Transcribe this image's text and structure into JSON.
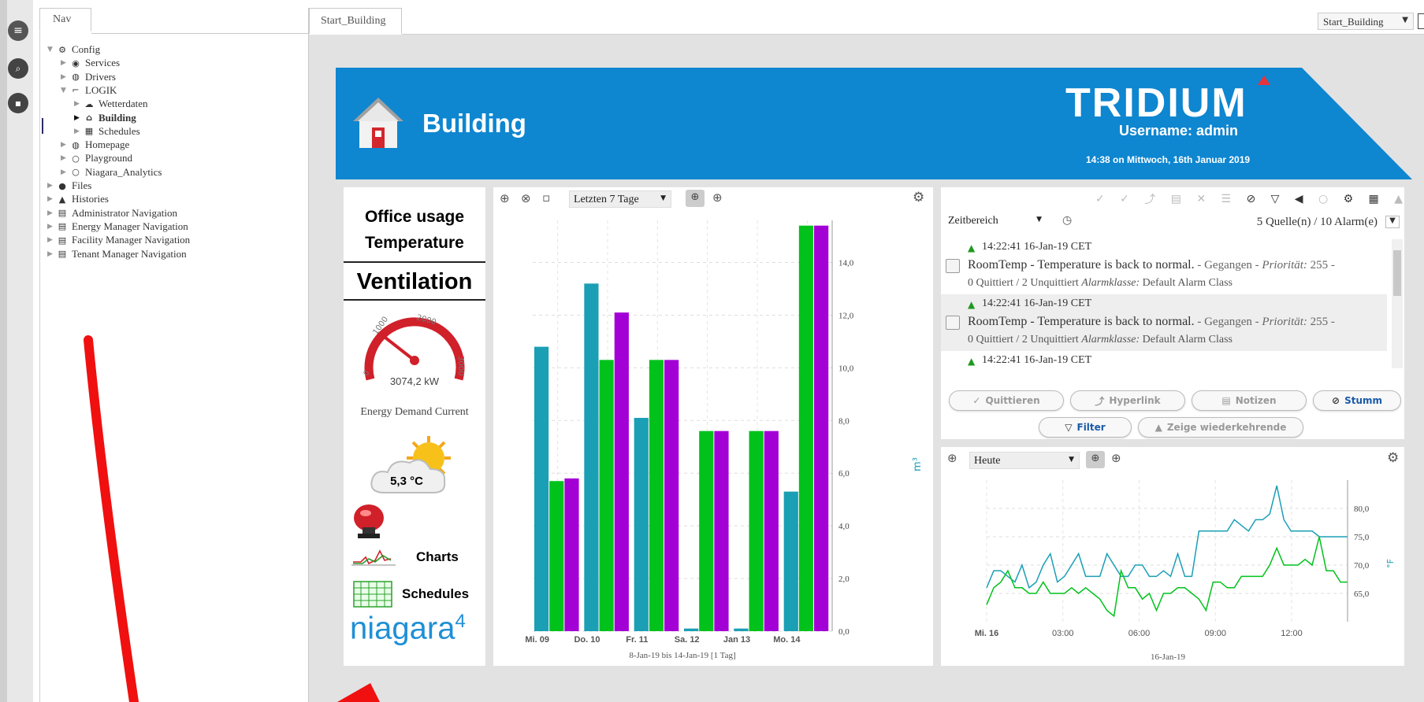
{
  "nav": {
    "tab_label": "Nav",
    "tree": [
      {
        "label": "Config",
        "icon": "config-icon",
        "level": 0,
        "expanded": true
      },
      {
        "label": "Services",
        "icon": "services-icon",
        "level": 1
      },
      {
        "label": "Drivers",
        "icon": "drivers-icon",
        "level": 1
      },
      {
        "label": "LOGIK",
        "icon": "logic-icon",
        "level": 1,
        "expanded": true
      },
      {
        "label": "Wetterdaten",
        "icon": "cloud-icon",
        "level": 2
      },
      {
        "label": "Building",
        "icon": "home-icon",
        "level": 2,
        "selected": true
      },
      {
        "label": "Schedules",
        "icon": "grid-icon",
        "level": 2
      },
      {
        "label": "Homepage",
        "icon": "globe-icon",
        "level": 1
      },
      {
        "label": "Playground",
        "icon": "circle-icon",
        "level": 1
      },
      {
        "label": "Niagara_Analytics",
        "icon": "circle-icon",
        "level": 1
      },
      {
        "label": "Files",
        "icon": "files-icon",
        "level": 0
      },
      {
        "label": "Histories",
        "icon": "histories-icon",
        "level": 0
      },
      {
        "label": "Administrator Navigation",
        "icon": "nav-file-icon",
        "level": 0
      },
      {
        "label": "Energy Manager Navigation",
        "icon": "nav-file-icon",
        "level": 0
      },
      {
        "label": "Facility Manager Navigation",
        "icon": "nav-file-icon",
        "level": 0
      },
      {
        "label": "Tenant Manager Navigation",
        "icon": "nav-file-icon",
        "level": 0
      }
    ]
  },
  "main": {
    "tab_label": "Start_Building",
    "view_select": "Start_Building"
  },
  "banner": {
    "title": "Building",
    "brand": "TRIDIUM",
    "username": "Username: admin",
    "timestamp": "14:38 on Mittwoch, 16th Januar 2019",
    "color": "#0e86d0"
  },
  "left_panel": {
    "line1": "Office usage",
    "line2": "Temperature",
    "ventilation": "Ventilation",
    "gauge": {
      "labels": [
        "0",
        "1000",
        "2000",
        "3000"
      ],
      "value": "3074,2 kW",
      "caption": "Energy Demand Current",
      "fraction": 1.0
    },
    "weather_temp": "5,3 °C",
    "charts_label": "Charts",
    "schedules_label": "Schedules",
    "logo": "niagara",
    "logo_sup": "4"
  },
  "bar_chart": {
    "range_select": "Letzten 7 Tage",
    "xlabel": "8-Jan-19 bis 14-Jan-19   [1 Tag]",
    "unit_label": "m³",
    "yticks": [
      "0,0",
      "2,0",
      "4,0",
      "6,0",
      "8,0",
      "10,0",
      "12,0",
      "14,0"
    ]
  },
  "alarms": {
    "time_range_select": "Zeitbereich",
    "source_count": "5 Quelle(n) / 10 Alarm(e)",
    "rows": [
      {
        "time": "14:22:41 16-Jan-19 CET",
        "msg": "RoomTemp - Temperature is back to normal.",
        "state": " - Gegangen - ",
        "prio_label": "Priorität:",
        "prio": " 255 -",
        "ack": "0 Quittiert / 2 Unquittiert ",
        "class_label": "Alarmklasse:",
        "class_val": " Default Alarm Class"
      },
      {
        "time": "14:22:41 16-Jan-19 CET",
        "msg": "RoomTemp - Temperature is back to normal.",
        "state": " - Gegangen - ",
        "prio_label": "Priorität:",
        "prio": " 255 -",
        "ack": "0 Quittiert / 2 Unquittiert ",
        "class_label": "Alarmklasse:",
        "class_val": " Default Alarm Class"
      },
      {
        "time": "14:22:41 16-Jan-19 CET"
      }
    ],
    "buttons": {
      "ack": "Quittieren",
      "hyperlink": "Hyperlink",
      "notes": "Notizen",
      "silence": "Stumm",
      "filter": "Filter",
      "recurring": "Zeige wiederkehrende"
    }
  },
  "trend": {
    "range_select": "Heute",
    "date_label": "16-Jan-19",
    "unit_label": "°F",
    "yticks": [
      "65,0",
      "70,0",
      "75,0",
      "80,0"
    ],
    "xticks": [
      "Mi. 16",
      "03:00",
      "06:00",
      "09:00",
      "12:00"
    ]
  },
  "chart_data": [
    {
      "type": "bar",
      "categories": [
        "Mi. 09",
        "Do. 10",
        "Fr. 11",
        "Sa. 12",
        "Jan 13",
        "Mo. 14"
      ],
      "ylim": [
        0,
        15.6
      ],
      "xlabel": "8-Jan-19 bis 14-Jan-19   [1 Tag]",
      "ylabel": "m³",
      "series": [
        {
          "color": "#1a9fb5",
          "values": [
            10.8,
            13.2,
            8.1,
            0.1,
            0.1,
            5.3
          ]
        },
        {
          "color": "#00c21b",
          "values": [
            5.7,
            10.3,
            10.3,
            7.6,
            7.6,
            15.4
          ]
        },
        {
          "color": "#a300d6",
          "values": [
            5.8,
            12.1,
            10.3,
            7.6,
            7.6,
            15.4
          ]
        }
      ]
    },
    {
      "type": "line",
      "xlabel": "16-Jan-19",
      "ylabel": "°F",
      "x_hours": [
        0,
        14.2
      ],
      "ylim": [
        60,
        85
      ],
      "xticks": [
        "Mi. 16",
        "03:00",
        "06:00",
        "09:00",
        "12:00"
      ],
      "series": [
        {
          "color": "#1a9fb5",
          "values": [
            66,
            69,
            69,
            68,
            67,
            70,
            66,
            67,
            70,
            72,
            67,
            68,
            70,
            72,
            68,
            68,
            68,
            72,
            70,
            68,
            68,
            70,
            70,
            68,
            68,
            69,
            68,
            72,
            68,
            68,
            76,
            76,
            76,
            76,
            76,
            78,
            77,
            76,
            78,
            78,
            79,
            84,
            78,
            76,
            76,
            76,
            76,
            75,
            75,
            75,
            75,
            75
          ]
        },
        {
          "color": "#00c21b",
          "values": [
            63,
            66,
            67,
            69,
            66,
            66,
            65,
            65,
            67,
            65,
            65,
            65,
            66,
            65,
            66,
            65,
            64,
            62,
            61,
            69,
            66,
            66,
            64,
            65,
            62,
            65,
            65,
            66,
            66,
            65,
            64,
            62,
            67,
            67,
            66,
            66,
            68,
            68,
            68,
            68,
            70,
            73,
            70,
            70,
            70,
            71,
            70,
            75,
            69,
            69,
            67,
            67
          ]
        }
      ]
    }
  ]
}
